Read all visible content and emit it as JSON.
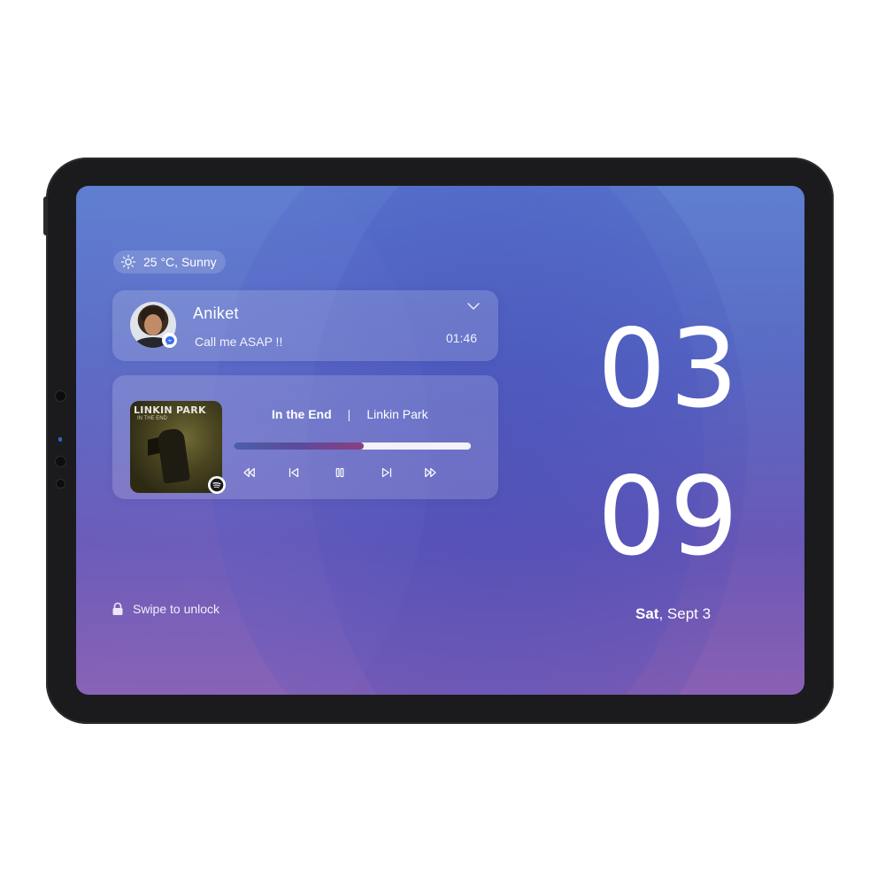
{
  "weather": {
    "label": "25 °C, Sunny",
    "icon": "sun-icon"
  },
  "notification": {
    "sender": "Aniket",
    "message": "Call me ASAP !!",
    "time": "01:46",
    "app_icon": "messenger-icon"
  },
  "music": {
    "album_art_text": "LINKIN PARK",
    "album_art_subtext": "IN THE END",
    "title": "In the End",
    "separator": "|",
    "artist": "Linkin Park",
    "progress": 0.55,
    "source_icon": "spotify-icon"
  },
  "clock": {
    "hour": "03",
    "minute": "09"
  },
  "date": {
    "day": "Sat",
    "rest": ", Sept 3"
  },
  "unlock": {
    "label": "Swipe to unlock"
  },
  "colors": {
    "accent_green": "#1db954",
    "messenger_blue": "#3a6ff0"
  }
}
